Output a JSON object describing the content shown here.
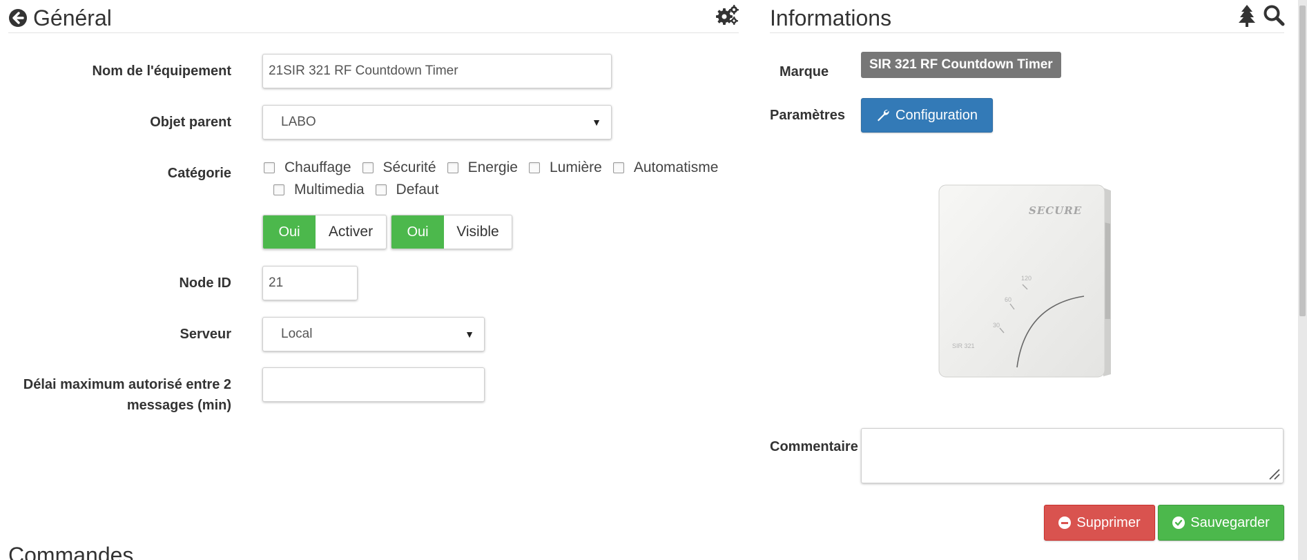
{
  "general": {
    "title": "Général",
    "fields": {
      "name_label": "Nom de l'équipement",
      "name_value": "21SIR 321 RF Countdown Timer",
      "parent_label": "Objet parent",
      "parent_value": "LABO",
      "category_label": "Catégorie",
      "categories": [
        "Chauffage",
        "Sécurité",
        "Energie",
        "Lumière",
        "Automatisme",
        "Multimedia",
        "Defaut"
      ],
      "activate_on": "Oui",
      "activate_label": "Activer",
      "visible_on": "Oui",
      "visible_label": "Visible",
      "node_label": "Node ID",
      "node_value": "21",
      "server_label": "Serveur",
      "server_value": "Local",
      "delay_label_1": "Délai maximum autorisé entre 2",
      "delay_label_2": "messages (min)",
      "delay_value": ""
    }
  },
  "informations": {
    "title": "Informations",
    "brand_label": "Marque",
    "brand_value": "SIR 321 RF Countdown Timer",
    "params_label": "Paramètres",
    "config_button": "Configuration",
    "device_brand": "SECURE",
    "device_model": "SIR 321",
    "device_ticks": [
      "120",
      "60",
      "30"
    ],
    "comment_label": "Commentaire",
    "comment_value": "",
    "delete_button": "Supprimer",
    "save_button": "Sauvegarder"
  },
  "commands": {
    "title": "Commandes"
  },
  "colors": {
    "green": "#4cb84c",
    "blue": "#337ab7",
    "red": "#d9534f",
    "badge": "#777777"
  },
  "icons": [
    "arrow-circle-left-icon",
    "gears-icon",
    "tree-icon",
    "search-icon",
    "wrench-icon",
    "minus-circle-icon",
    "check-circle-icon"
  ]
}
